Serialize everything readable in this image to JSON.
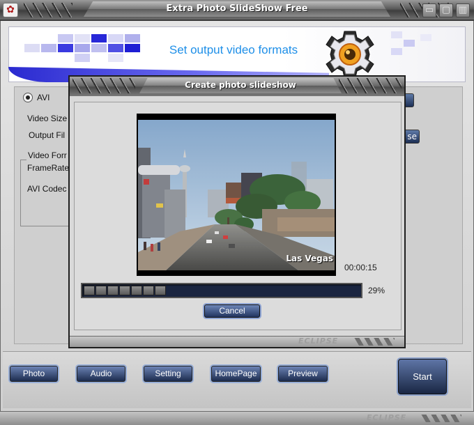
{
  "app": {
    "title": "Extra Photo SlideShow Free",
    "banner_title": "Set output video formats",
    "footer_brand": "ECLIPSE"
  },
  "background_form": {
    "format_option": "AVI",
    "video_size_label": "Video Size",
    "output_file_label": "Output Fil",
    "group_label": "Video Forr",
    "framerate_label": "FrameRate",
    "avi_codec_label": "AVI Codec",
    "browse_button_fragment": "se"
  },
  "dialog": {
    "title": "Create photo slideshow",
    "video_caption": "Las Vegas",
    "timecode": "00:00:15",
    "progress_value": 29,
    "progress_label": "29%",
    "cancel_label": "Cancel",
    "footer_brand": "ECLIPSE"
  },
  "toolbar": {
    "photo_label": "Photo",
    "audio_label": "Audio",
    "setting_label": "Setting",
    "homepage_label": "HomePage",
    "preview_label": "Preview",
    "start_label": "Start"
  },
  "colors": {
    "button_dark": "#1c2c4e",
    "banner_text": "#1e8fe8",
    "progress_track": "#1a2540"
  },
  "icons": [
    "app-icon",
    "minimize-icon",
    "maximize-icon",
    "close-icon",
    "gear-icon",
    "radio-selected-icon"
  ]
}
